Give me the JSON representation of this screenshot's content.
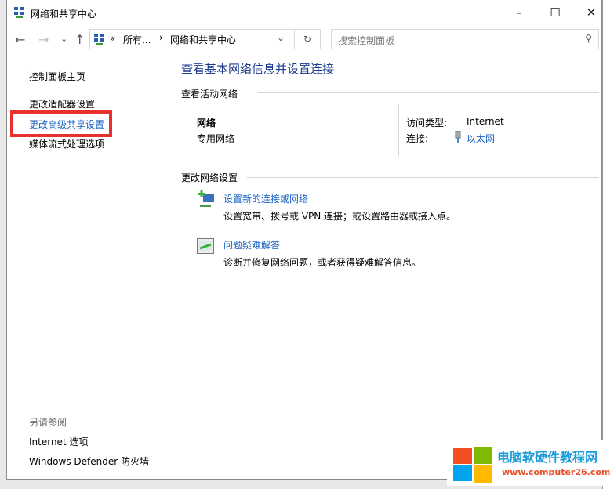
{
  "window": {
    "title": "网络和共享中心",
    "minimize": "–",
    "maximize": "☐",
    "close": "✕"
  },
  "nav": {
    "back": "←",
    "forward": "→",
    "recent": "⌄",
    "up": "↑",
    "breadcrumb_sep": "«",
    "crumb1": "所有...",
    "crumb_arrow": "›",
    "crumb2": "网络和共享中心",
    "dropdown": "⌄",
    "refresh": "↻",
    "search_placeholder": "搜索控制面板",
    "search_icon": "⚲"
  },
  "sidebar": {
    "home": "控制面板主页",
    "items": [
      "更改适配器设置",
      "更改高级共享设置",
      "媒体流式处理选项"
    ],
    "see_also": "另请参阅",
    "see_also_items": [
      "Internet 选项",
      "Windows Defender 防火墙"
    ]
  },
  "main": {
    "heading": "查看基本网络信息并设置连接",
    "active_header": "查看活动网络",
    "network_name": "网络",
    "network_type": "专用网络",
    "access_label": "访问类型:",
    "access_value": "Internet",
    "conn_label": "连接:",
    "conn_value": "以太网",
    "change_header": "更改网络设置",
    "tasks": [
      {
        "title": "设置新的连接或网络",
        "desc": "设置宽带、拨号或 VPN 连接；或设置路由器或接入点。"
      },
      {
        "title": "问题疑难解答",
        "desc": "诊断并修复网络问题，或者获得疑难解答信息。"
      }
    ]
  },
  "watermark": {
    "brand": "电脑软硬件教程网",
    "url": "www.computer26.com"
  },
  "highlight_color": "#e8312f",
  "link_color": "#1a63c7"
}
